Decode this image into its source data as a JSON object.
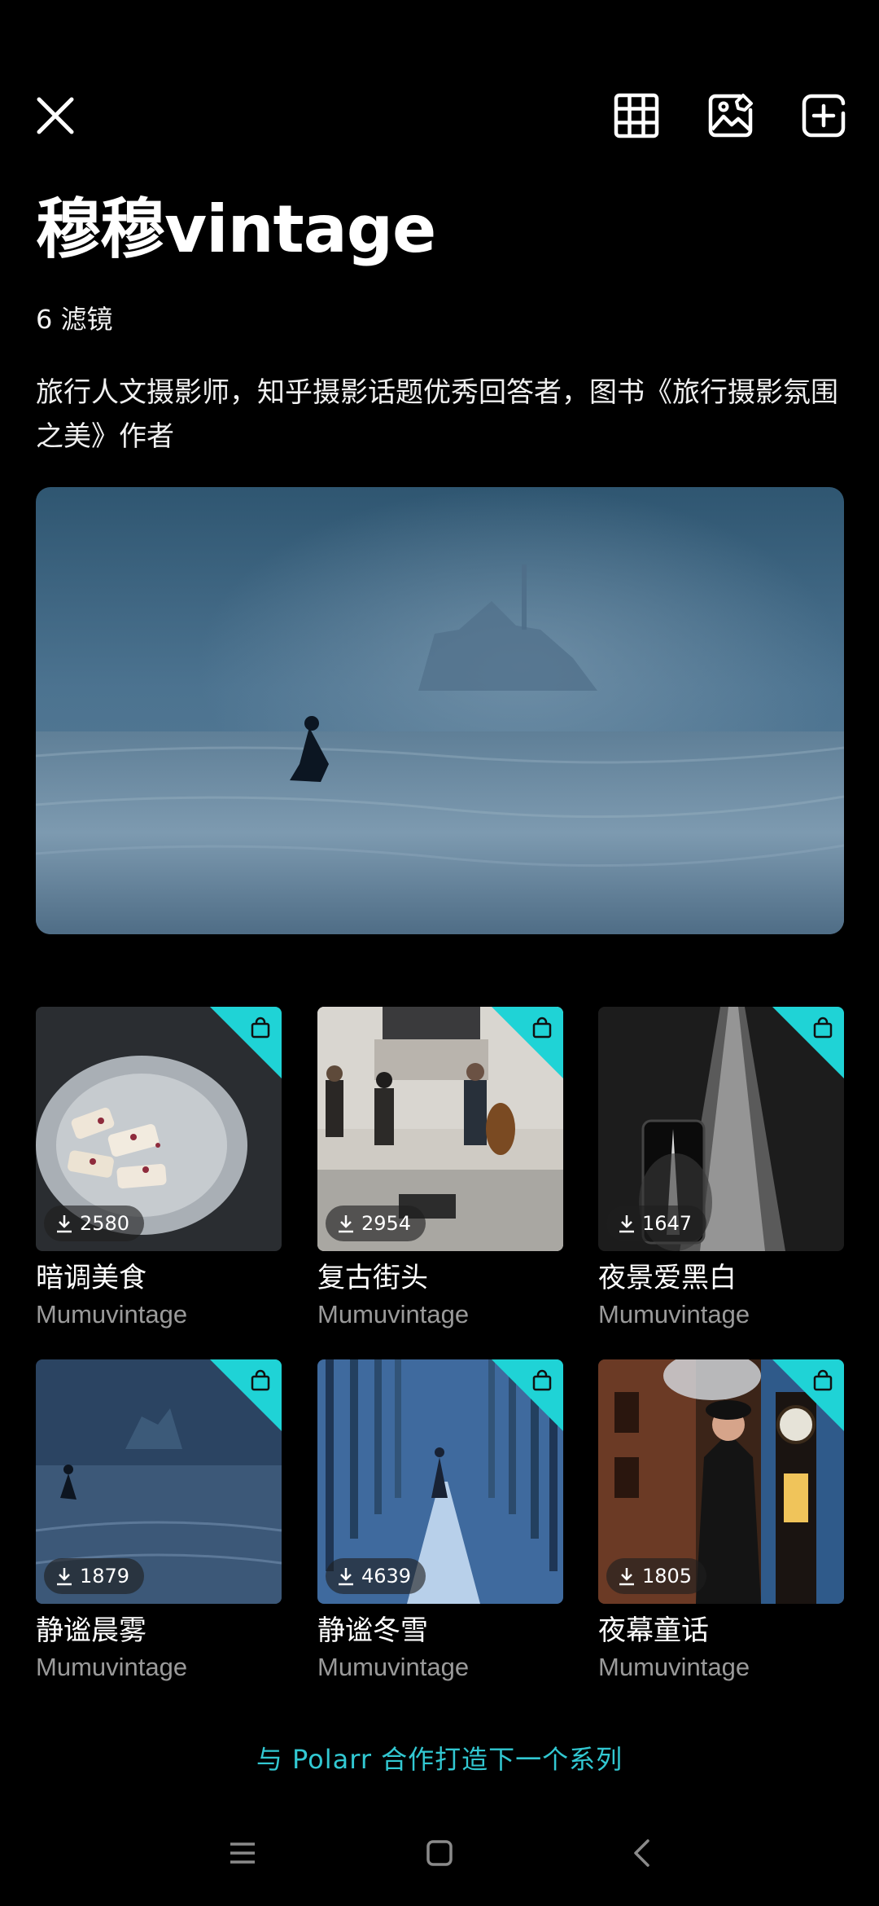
{
  "header": {
    "close_icon": "close-icon",
    "actions": [
      "grid-icon",
      "image-edit-icon",
      "add-icon"
    ]
  },
  "profile": {
    "title": "穆穆vintage",
    "filter_count": "6 滤镜",
    "description": "旅行人文摄影师，知乎摄影话题优秀回答者，图书《旅行摄影氛围之美》作者"
  },
  "filters": [
    {
      "name": "暗调美食",
      "author": "Mumuvintage",
      "downloads": "2580"
    },
    {
      "name": "复古街头",
      "author": "Mumuvintage",
      "downloads": "2954"
    },
    {
      "name": "夜景爱黑白",
      "author": "Mumuvintage",
      "downloads": "1647"
    },
    {
      "name": "静谧晨雾",
      "author": "Mumuvintage",
      "downloads": "1879"
    },
    {
      "name": "静谧冬雪",
      "author": "Mumuvintage",
      "downloads": "4639"
    },
    {
      "name": "夜幕童话",
      "author": "Mumuvintage",
      "downloads": "1805"
    }
  ],
  "cta": "与 Polarr 合作打造下一个系列",
  "colors": {
    "accent": "#1fd3d6",
    "cta_text": "#32c8d2",
    "background": "#000000"
  },
  "system_nav": [
    "menu-icon",
    "home-icon",
    "back-icon"
  ]
}
